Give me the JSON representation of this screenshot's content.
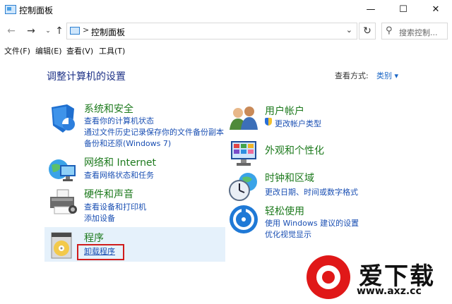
{
  "window": {
    "title": "控制面板",
    "minimize": "—",
    "maximize": "☐",
    "close": "✕"
  },
  "nav": {
    "back": "←",
    "forward": "→",
    "recent": "⌄",
    "up": "↑",
    "refresh": "↻"
  },
  "address": {
    "separator": ">",
    "path": "控制面板",
    "dropdown": "⌄"
  },
  "search": {
    "icon": "⚲",
    "placeholder": "搜索控制..."
  },
  "menu": [
    "文件(F)",
    "编辑(E)",
    "查看(V)",
    "工具(T)"
  ],
  "content": {
    "title": "调整计算机的设置",
    "view_by_label": "查看方式:",
    "view_by_value": "类别 ▾"
  },
  "categories": [
    {
      "title": "系统和安全",
      "icon": "shield-icon",
      "links": [
        "查看你的计算机状态",
        "通过文件历史记录保存你的文件备份副本",
        "备份和还原(Windows 7)"
      ]
    },
    {
      "title": "网络和 Internet",
      "icon": "network-globe-icon",
      "links": [
        "查看网络状态和任务"
      ]
    },
    {
      "title": "硬件和声音",
      "icon": "printer-icon",
      "links": [
        "查看设备和打印机",
        "添加设备"
      ]
    },
    {
      "title": "程序",
      "icon": "programs-disc-icon",
      "links": [
        "卸载程序"
      ]
    },
    {
      "title": "用户帐户",
      "icon": "users-icon",
      "links": [
        "更改帐户类型"
      ]
    },
    {
      "title": "外观和个性化",
      "icon": "monitor-palette-icon",
      "links": []
    },
    {
      "title": "时钟和区域",
      "icon": "clock-globe-icon",
      "links": [
        "更改日期、时间或数字格式"
      ]
    },
    {
      "title": "轻松使用",
      "icon": "ease-of-access-icon",
      "links": [
        "使用 Windows 建议的设置",
        "优化视觉显示"
      ]
    }
  ],
  "watermark": {
    "title": "爱下载",
    "url": "www.axz.cc"
  },
  "colors": {
    "category_title": "#1d7a1d",
    "link": "#1a4fb3",
    "heading": "#1e3287",
    "highlight": "#e5f1fb",
    "annotation_box": "#d01c1c",
    "watermark_red": "#e01818"
  }
}
